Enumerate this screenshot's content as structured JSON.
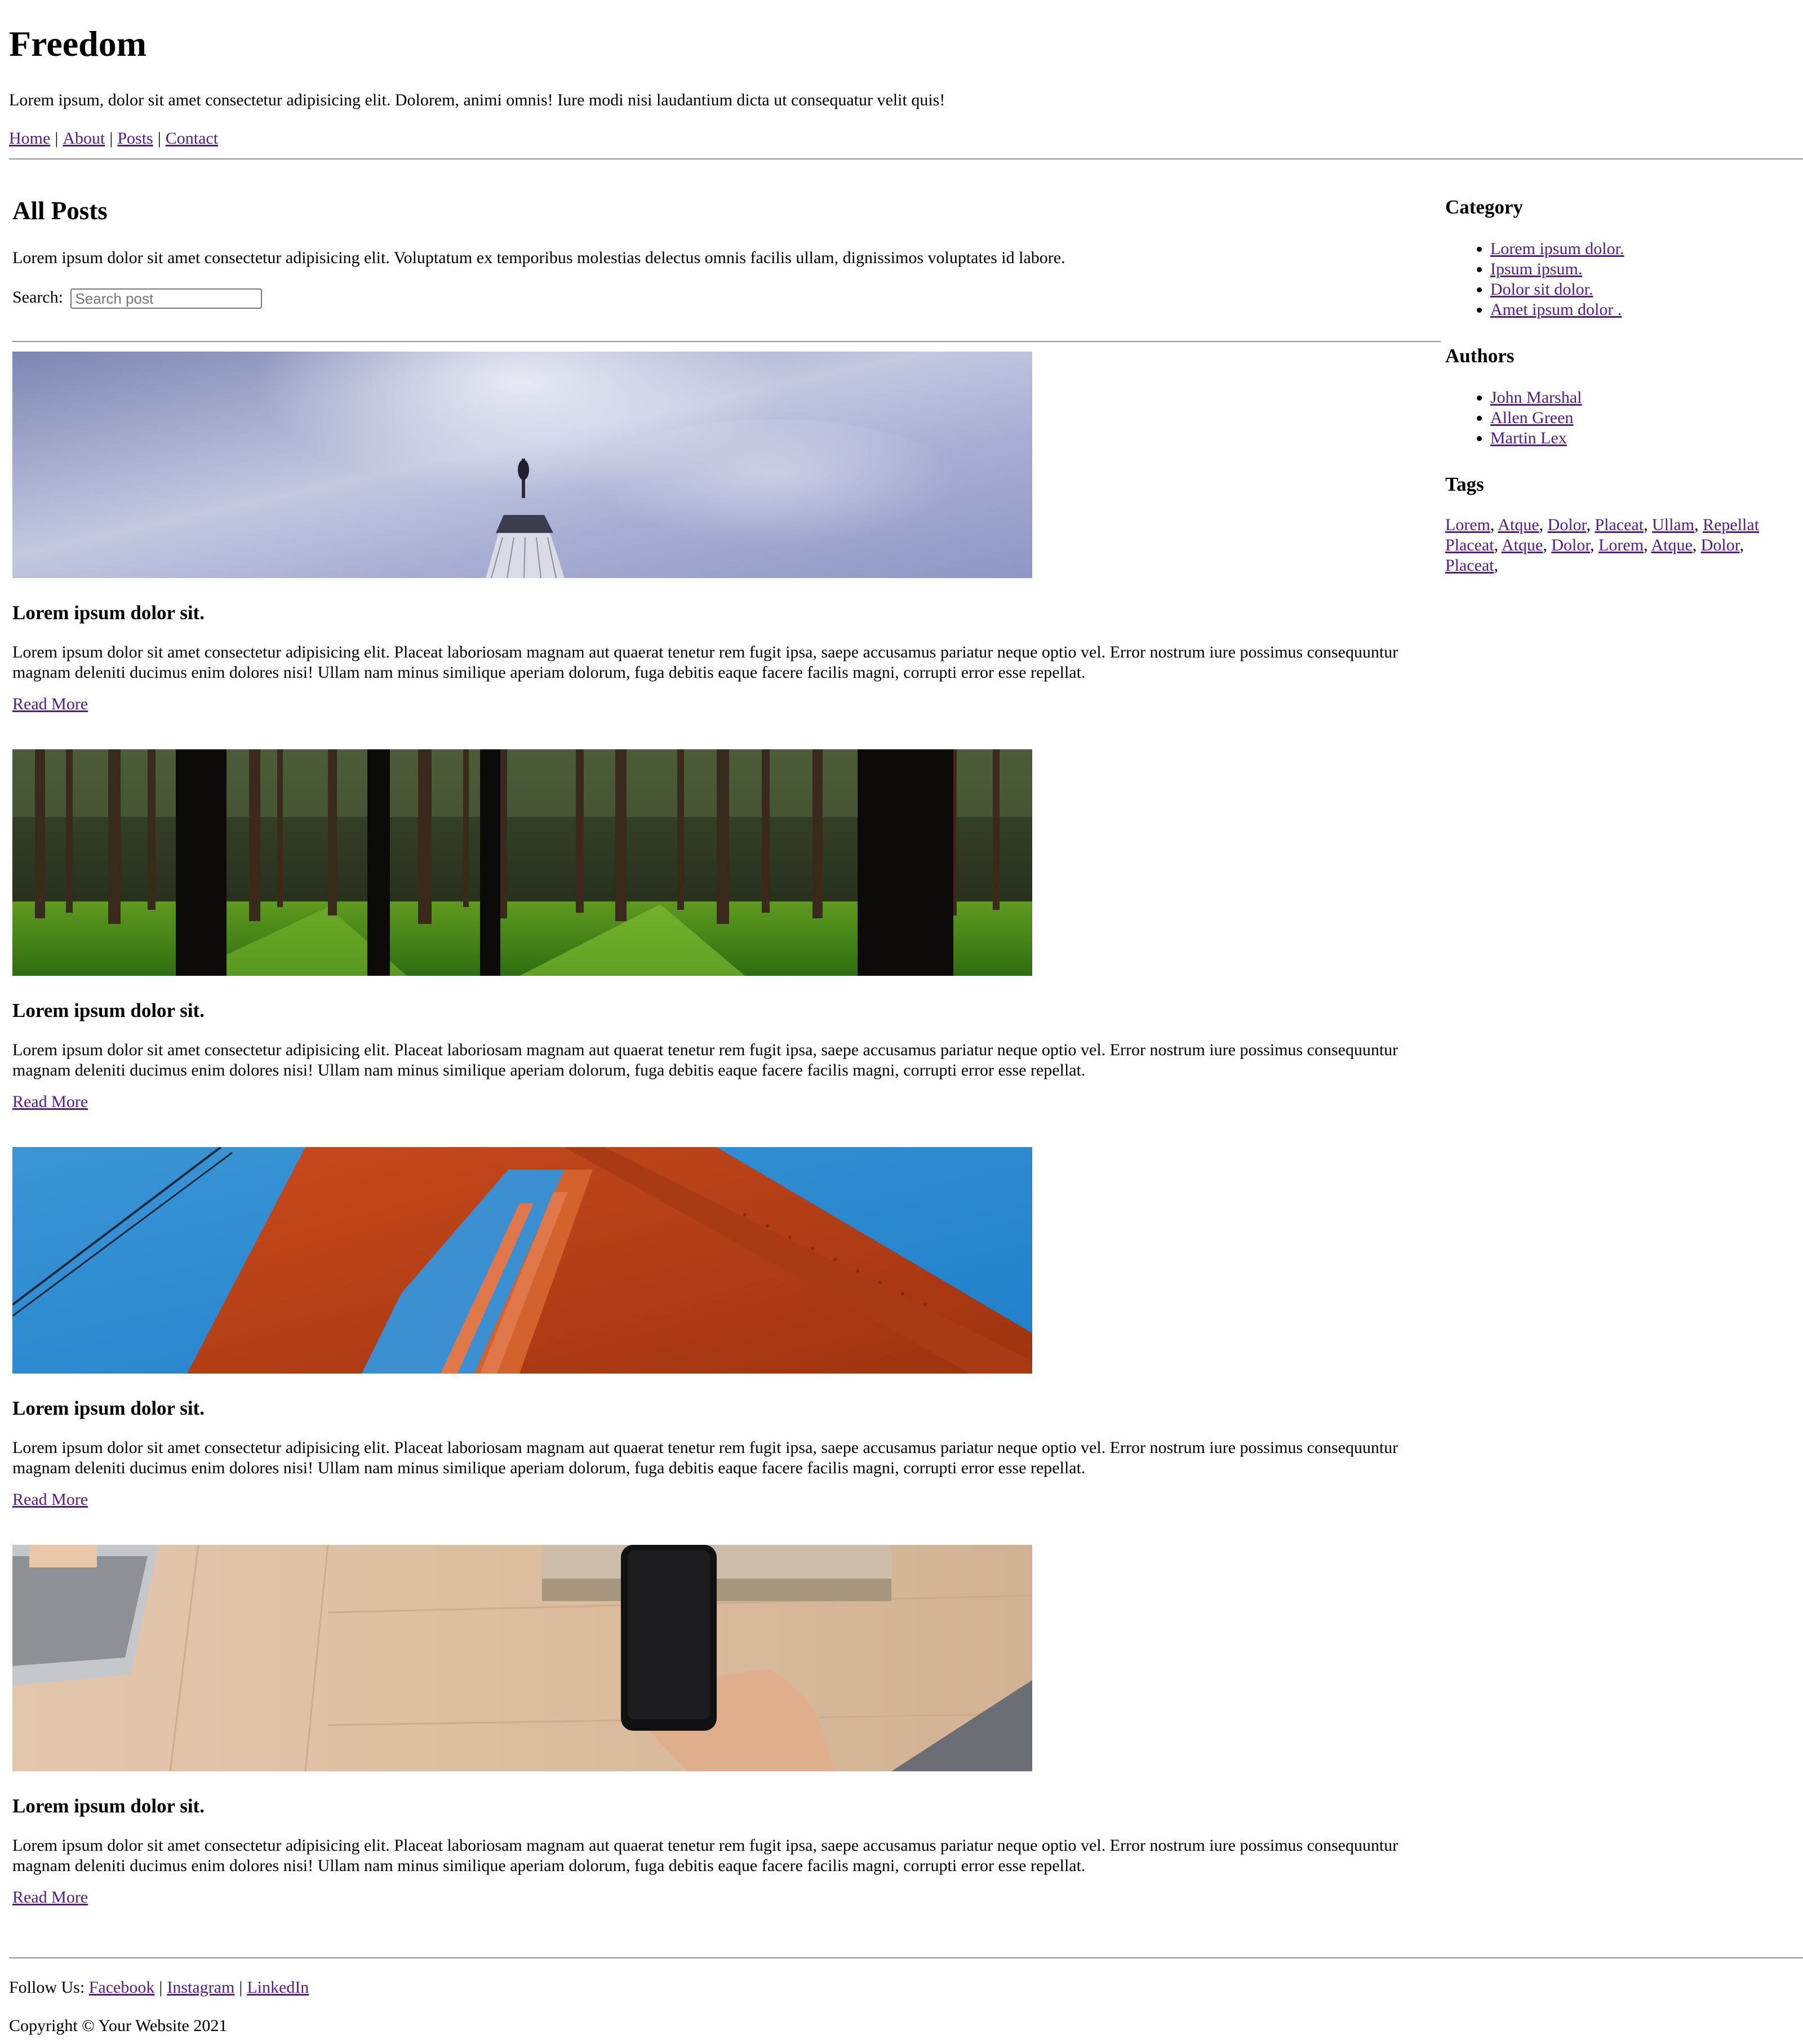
{
  "site": {
    "title": "Freedom",
    "tagline": "Lorem ipsum, dolor sit amet consectetur adipisicing elit. Dolorem, animi omnis! Iure modi nisi laudantium dicta ut consequatur velit quis!"
  },
  "nav": {
    "items": [
      {
        "label": "Home"
      },
      {
        "label": "About"
      },
      {
        "label": "Posts"
      },
      {
        "label": "Contact"
      }
    ],
    "separator": "|"
  },
  "main": {
    "title": "All Posts",
    "intro": "Lorem ipsum dolor sit amet consectetur adipisicing elit. Voluptatum ex temporibus molestias delectus omnis facilis ullam, dignissimos voluptates id labore.",
    "search": {
      "label": "Search:",
      "placeholder": "Search post"
    },
    "posts": [
      {
        "image": "skyscraper-sky",
        "title": "Lorem ipsum dolor sit.",
        "text": "Lorem ipsum dolor sit amet consectetur adipisicing elit. Placeat laboriosam magnam aut quaerat tenetur rem fugit ipsa, saepe accusamus pariatur neque optio vel. Error nostrum iure possimus consequuntur magnam deleniti ducimus enim dolores nisi! Ullam nam minus similique aperiam dolorum, fuga debitis eaque facere facilis magni, corrupti error esse repellat.",
        "link": "Read More"
      },
      {
        "image": "forest",
        "title": "Lorem ipsum dolor sit.",
        "text": "Lorem ipsum dolor sit amet consectetur adipisicing elit. Placeat laboriosam magnam aut quaerat tenetur rem fugit ipsa, saepe accusamus pariatur neque optio vel. Error nostrum iure possimus consequuntur magnam deleniti ducimus enim dolores nisi! Ullam nam minus similique aperiam dolorum, fuga debitis eaque facere facilis magni, corrupti error esse repellat.",
        "link": "Read More"
      },
      {
        "image": "red-bridge",
        "title": "Lorem ipsum dolor sit.",
        "text": "Lorem ipsum dolor sit amet consectetur adipisicing elit. Placeat laboriosam magnam aut quaerat tenetur rem fugit ipsa, saepe accusamus pariatur neque optio vel. Error nostrum iure possimus consequuntur magnam deleniti ducimus enim dolores nisi! Ullam nam minus similique aperiam dolorum, fuga debitis eaque facere facilis magni, corrupti error esse repellat.",
        "link": "Read More"
      },
      {
        "image": "desk-phone",
        "title": "Lorem ipsum dolor sit.",
        "text": "Lorem ipsum dolor sit amet consectetur adipisicing elit. Placeat laboriosam magnam aut quaerat tenetur rem fugit ipsa, saepe accusamus pariatur neque optio vel. Error nostrum iure possimus consequuntur magnam deleniti ducimus enim dolores nisi! Ullam nam minus similique aperiam dolorum, fuga debitis eaque facere facilis magni, corrupti error esse repellat.",
        "link": "Read More"
      }
    ]
  },
  "sidebar": {
    "category": {
      "heading": "Category",
      "items": [
        "Lorem ipsum dolor.",
        "Ipsum ipsum.",
        "Dolor sit dolor.",
        "Amet ipsum dolor ."
      ]
    },
    "authors": {
      "heading": "Authors",
      "items": [
        "John Marshal",
        "Allen Green",
        "Martin Lex"
      ]
    },
    "tags": {
      "heading": "Tags",
      "items": [
        "Lorem",
        "Atque",
        "Dolor",
        "Placeat",
        "Ullam",
        "Repellat",
        "Placeat",
        "Atque",
        "Dolor",
        "Lorem",
        "Atque",
        "Dolor",
        "Placeat"
      ]
    }
  },
  "footer": {
    "follow_label": "Follow Us:",
    "social": [
      "Facebook",
      "Instagram",
      "LinkedIn"
    ],
    "copyright": "Copyright © Your Website 2021"
  },
  "colors": {
    "link": "#551a8b",
    "rule": "#9a9a9a",
    "text": "#000000"
  }
}
